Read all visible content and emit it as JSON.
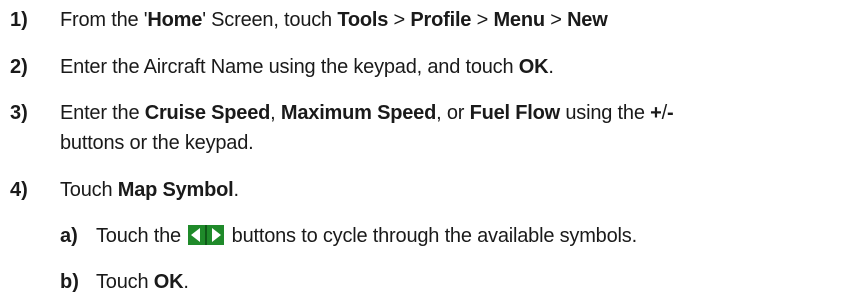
{
  "steps": [
    {
      "number": "1)",
      "parts": [
        "From the '",
        "Home",
        "' Screen, touch ",
        "Tools",
        " > ",
        "Profile",
        " > ",
        "Menu",
        " > ",
        "New"
      ]
    },
    {
      "number": "2)",
      "parts": [
        "Enter the Aircraft Name using the keypad, and touch ",
        "OK",
        "."
      ]
    },
    {
      "number": "3)",
      "parts": [
        "Enter the ",
        "Cruise Speed",
        ", ",
        "Maximum Speed",
        ", or ",
        "Fuel Flow",
        " using the ",
        "+",
        "/",
        "-"
      ],
      "line2": "buttons or the keypad."
    },
    {
      "number": "4)",
      "parts": [
        "Touch ",
        "Map Symbol",
        "."
      ]
    }
  ],
  "substeps": [
    {
      "letter": "a)",
      "before": "Touch the ",
      "icon": "left-right-arrow-buttons-icon",
      "after": " buttons to cycle through the available symbols."
    },
    {
      "letter": "b)",
      "parts": [
        "Touch ",
        "OK",
        "."
      ]
    }
  ],
  "colors": {
    "text": "#1a1a1a",
    "arrow_button": "#1f8a2a"
  }
}
